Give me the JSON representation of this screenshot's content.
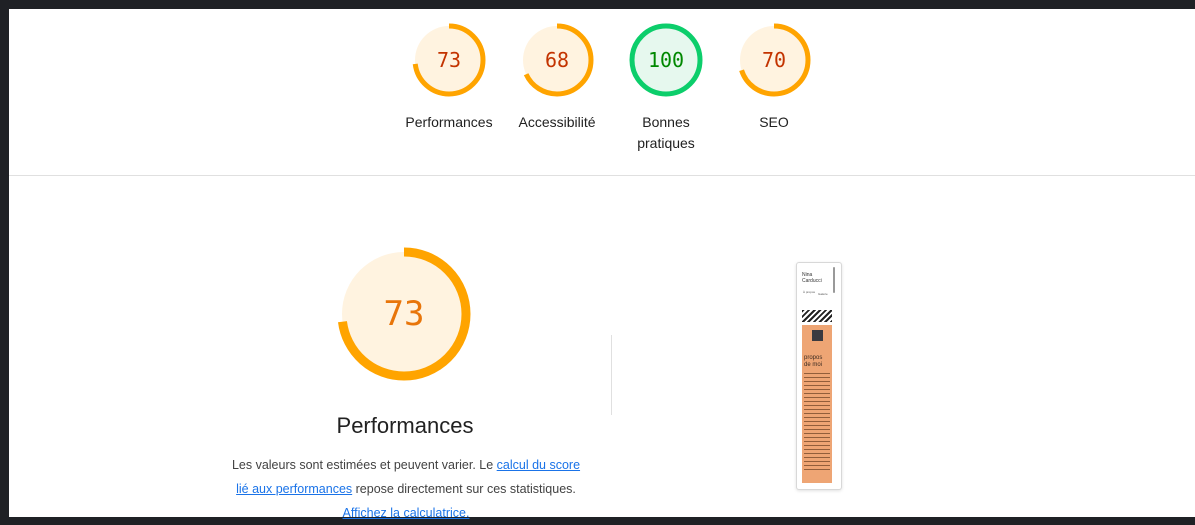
{
  "scores": [
    {
      "value": "73",
      "label": "Performances",
      "color": "#ffa400",
      "text_color": "#c33300",
      "bg": "#fff3e0",
      "fraction": 0.73
    },
    {
      "value": "68",
      "label": "Accessibilité",
      "color": "#ffa400",
      "text_color": "#c33300",
      "bg": "#fff3e0",
      "fraction": 0.68
    },
    {
      "value": "100",
      "label": "Bonnes pratiques",
      "color": "#0cce6b",
      "text_color": "#008800",
      "bg": "#e6f8ee",
      "fraction": 1.0
    },
    {
      "value": "70",
      "label": "SEO",
      "color": "#ffa400",
      "text_color": "#c33300",
      "bg": "#fff3e0",
      "fraction": 0.7
    }
  ],
  "performance": {
    "score": "73",
    "fraction": 0.73,
    "title": "Performances",
    "desc_part1": "Les valeurs sont estimées et peuvent varier. Le ",
    "desc_link1": "calcul du score lié aux performances",
    "desc_part2": " repose directement sur ces statistiques. ",
    "desc_link2": "Affichez la calculatrice."
  },
  "thumbnail": {
    "name": "Nina Carducci",
    "nav1": "À propos",
    "nav2": "Galerie",
    "about": "propos de moi"
  }
}
